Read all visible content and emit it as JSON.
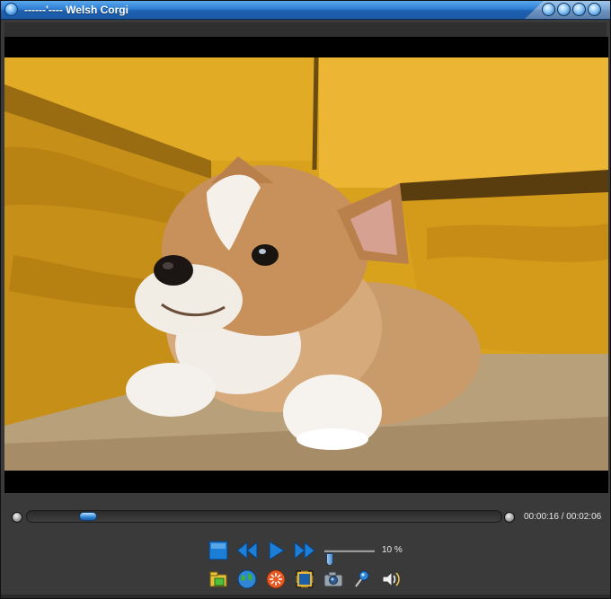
{
  "window": {
    "title": "------'---- Welsh Corgi",
    "controls": [
      "minimize-icon",
      "restore-icon",
      "maximize-icon",
      "close-icon"
    ]
  },
  "video": {
    "subject": "corgi-puppy-frame"
  },
  "playback": {
    "progress": 0.129,
    "time_label": "00:00:16 / 00:02:06"
  },
  "volume": {
    "level": 0.1,
    "label": "10 %"
  },
  "buttons": {
    "stop": "stop-icon",
    "rewind": "rewind-icon",
    "play": "play-icon",
    "fast_forward": "fast-forward-icon",
    "seek_back": "seek-back-icon",
    "seek_forward": "seek-forward-icon"
  },
  "tools": [
    "open-file-icon",
    "globe-icon",
    "bundle-icon",
    "fullscreen-icon",
    "snapshot-icon",
    "pin-icon",
    "sound-icon"
  ],
  "colors": {
    "titlebar": "#2f7fd4",
    "accent": "#1d7ed8",
    "panel": "#3a3a3a"
  }
}
